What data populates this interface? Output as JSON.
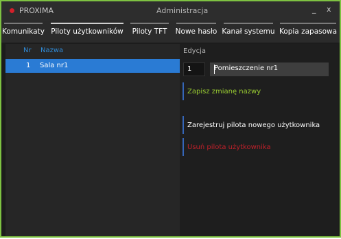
{
  "window": {
    "app_name": "PROXIMA",
    "title": "Administracja",
    "minimize_label": "_",
    "close_label": "x",
    "accent": "#7ec242"
  },
  "tabs": [
    {
      "label": "Komunikaty",
      "active": false
    },
    {
      "label": "Piloty użytkowników",
      "active": true
    },
    {
      "label": "Piloty TFT",
      "active": false
    },
    {
      "label": "Nowe hasło",
      "active": false
    },
    {
      "label": "Kanał systemu",
      "active": false
    },
    {
      "label": "Kopia zapasowa",
      "active": false
    }
  ],
  "list": {
    "columns": {
      "nr": "Nr",
      "name": "Nazwa"
    },
    "rows": [
      {
        "nr": "1",
        "name": "Sala nr1",
        "selected": true
      }
    ]
  },
  "edit": {
    "header": "Edycja",
    "nr_value": "1",
    "name_value": "Pomieszczenie nr1",
    "save_label": "Zapisz zmianę nazwy",
    "register_label": "Zarejestruj pilota nowego użytkownika",
    "remove_label": "Usuń pilota użytkownika"
  },
  "colors": {
    "selection": "#2a7bd4",
    "header_blue": "#2f8bd8",
    "save_green": "#9acd32",
    "remove_red": "#c0202a",
    "app_dot": "#d4202a"
  }
}
